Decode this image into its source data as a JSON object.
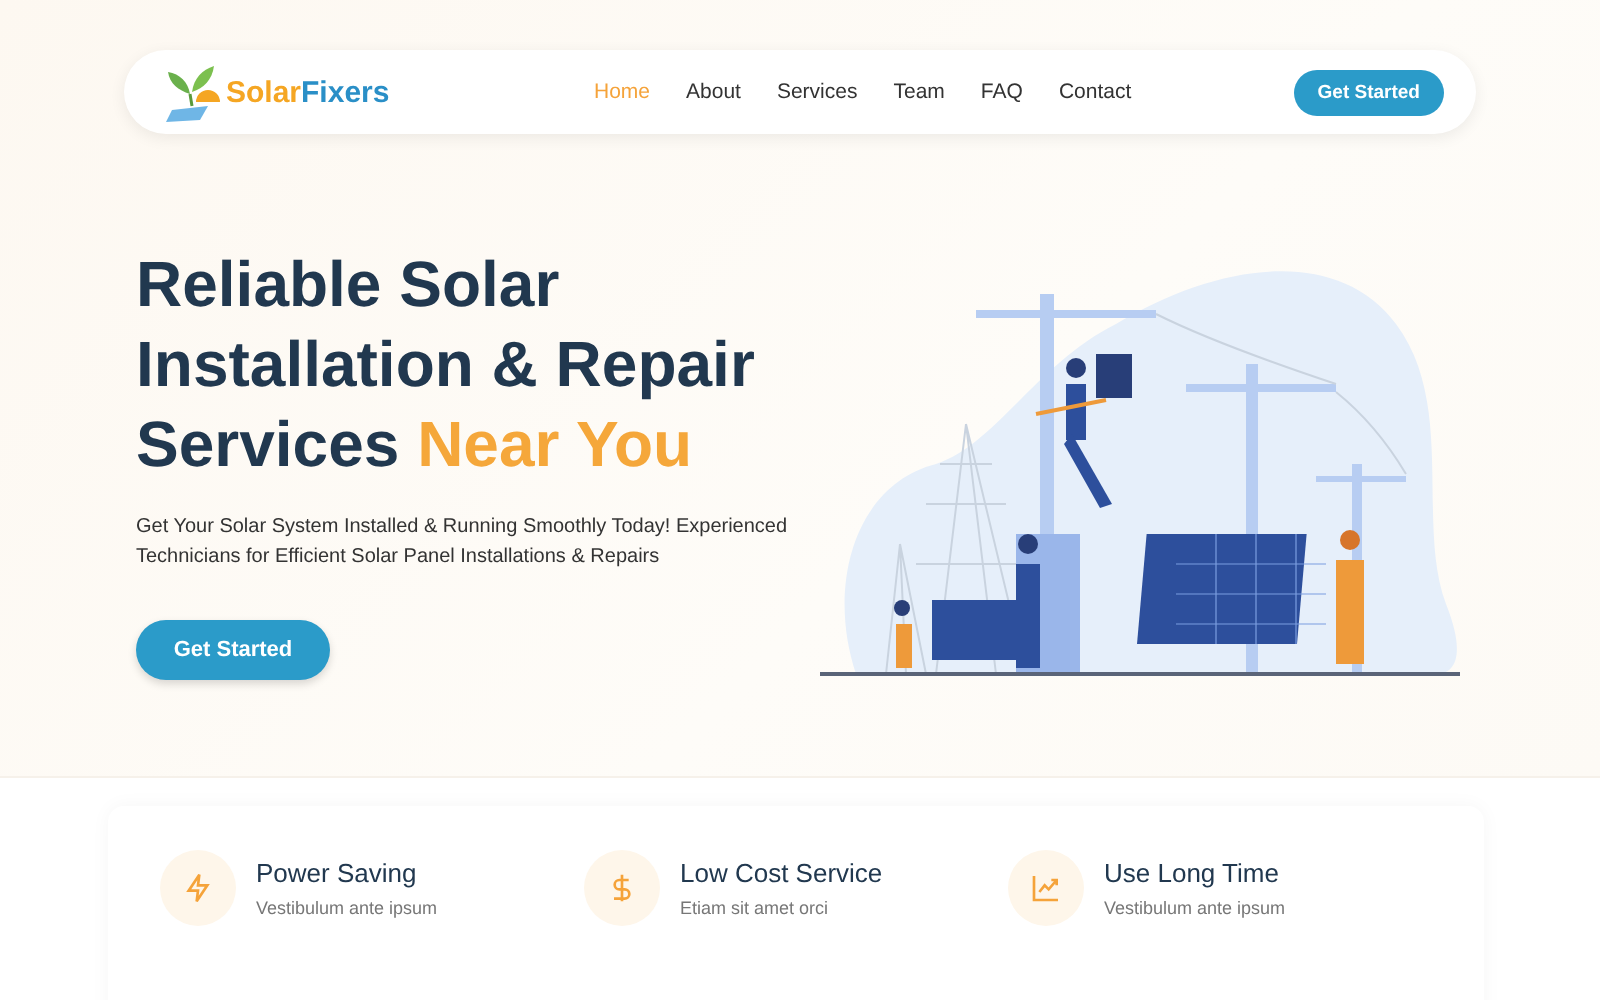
{
  "navbar": {
    "logo": {
      "first": "Solar",
      "second": "Fixers"
    },
    "links": [
      {
        "label": "Home",
        "selected": true
      },
      {
        "label": "About",
        "selected": false
      },
      {
        "label": "Services",
        "selected": false
      },
      {
        "label": "Team",
        "selected": false
      },
      {
        "label": "FAQ",
        "selected": false
      },
      {
        "label": "Contact",
        "selected": false
      }
    ],
    "button": "Get Started"
  },
  "hero": {
    "title": "Reliable Solar Installation & Repair Services",
    "title_highlight": "Near You",
    "subtitle": "Get Your Solar System Installed & Running Smoothly Today! Experienced Technicians for Efficient Solar Panel Installations & Repairs",
    "button": "Get Started"
  },
  "features": [
    {
      "kind": "bolt",
      "title": "Power Saving",
      "text": "Vestibulum ante ipsum"
    },
    {
      "kind": "dollar",
      "title": "Low Cost Service",
      "text": "Etiam sit amet orci"
    },
    {
      "kind": "chart",
      "title": "Use Long Time",
      "text": "Vestibulum ante ipsum"
    }
  ]
}
